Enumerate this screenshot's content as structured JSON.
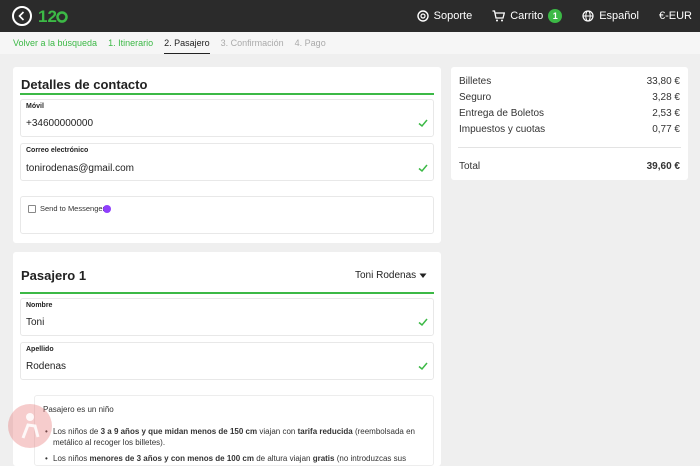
{
  "topbar": {
    "logo_text": "12go",
    "support": "Soporte",
    "cart": "Carrito",
    "cart_count": "1",
    "language": "Español",
    "currency": "€-EUR"
  },
  "steps": [
    {
      "label": "Volver a la búsqueda",
      "state": "link"
    },
    {
      "label": "1. Itinerario",
      "state": "link"
    },
    {
      "label": "2. Pasajero",
      "state": "active"
    },
    {
      "label": "3. Confirmación",
      "state": "disabled"
    },
    {
      "label": "4. Pago",
      "state": "disabled"
    }
  ],
  "contact": {
    "title": "Detalles de contacto",
    "mobile_label": "Móvil",
    "mobile_value": "+34600000000",
    "email_label": "Correo electrónico",
    "email_value": "tonirodenas@gmail.com",
    "messenger_label": "Send to Messenger"
  },
  "passenger": {
    "title": "Pasajero 1",
    "selector": "Toni Rodenas",
    "name_label": "Nombre",
    "name_value": "Toni",
    "surname_label": "Apellido",
    "surname_value": "Rodenas"
  },
  "child_info": {
    "title": "Pasajero es un niño",
    "b1_pre": "Los niños de ",
    "b1_bold1": "3 a 9 años y que midan menos de 150 cm",
    "b1_mid": " viajan con ",
    "b1_bold2": "tarifa reducida",
    "b1_post": " (reembolsada en metálico al recoger los billetes).",
    "b2_pre": "Los niños ",
    "b2_bold1": "menores de 3 años y con menos de 100 cm",
    "b2_mid": " de altura viajan ",
    "b2_bold2": "gratis",
    "b2_post": " (no introduzcas sus"
  },
  "summary": {
    "rows": [
      {
        "label": "Billetes",
        "value": "33,80 €"
      },
      {
        "label": "Seguro",
        "value": "3,28 €"
      },
      {
        "label": "Entrega de Boletos",
        "value": "2,53 €"
      },
      {
        "label": "Impuestos y cuotas",
        "value": "0,77 €"
      }
    ],
    "total_label": "Total",
    "total_value": "39,60 €"
  },
  "colors": {
    "accent": "#3cb946",
    "topbar": "#2b2b2b",
    "background": "#efefef"
  }
}
